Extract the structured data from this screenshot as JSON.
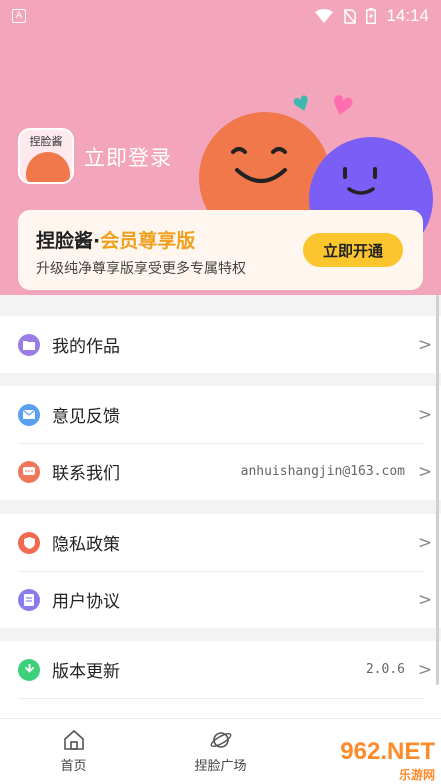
{
  "status_bar": {
    "time": "14:14"
  },
  "header": {
    "avatar_text": "捏脸酱",
    "login_label": "立即登录"
  },
  "vip": {
    "brand": "捏脸酱",
    "separator": "·",
    "level": "会员尊享版",
    "description": "升级纯净尊享版享受更多专属特权",
    "button": "立即开通"
  },
  "menu": {
    "works": "我的作品",
    "feedback": "意见反馈",
    "contact": "联系我们",
    "contact_email": "anhuishangjin@163.com",
    "privacy": "隐私政策",
    "agreement": "用户协议",
    "update": "版本更新",
    "version": "2.0.6"
  },
  "icons": {
    "works": "folder-icon",
    "feedback": "mail-icon",
    "contact": "chat-icon",
    "privacy": "shield-icon",
    "agreement": "document-icon",
    "update": "download-icon"
  },
  "colors": {
    "header_bg": "#f3a6bb",
    "accent_yellow": "#fbc52d",
    "works": "#9b7be6",
    "feedback": "#5aa0f0",
    "contact": "#f0785a",
    "privacy": "#f06a50",
    "agreement": "#8a7bf0",
    "update": "#3ecf7a"
  },
  "bottom_nav": {
    "home": "首页",
    "square": "捏脸广场"
  },
  "watermark": {
    "main": "962.NET",
    "sub": "乐游网"
  }
}
